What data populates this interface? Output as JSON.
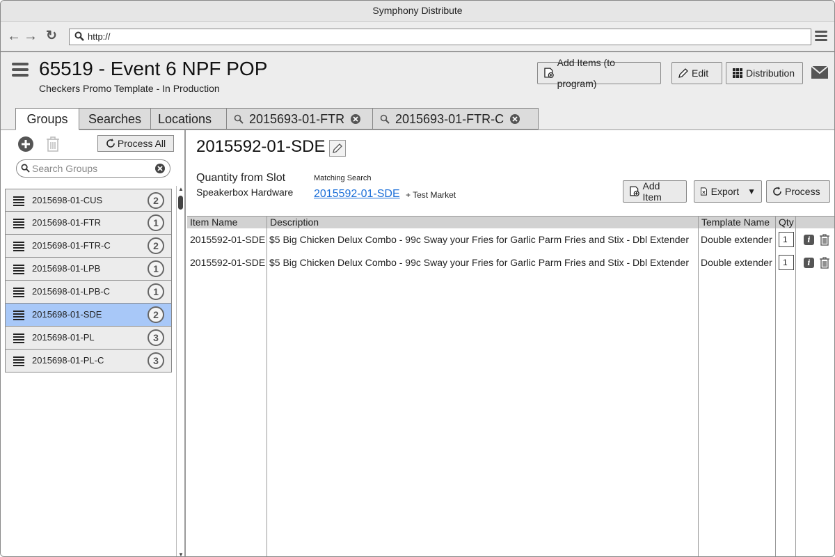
{
  "window": {
    "title": "Symphony Distribute"
  },
  "browser": {
    "url": "http://"
  },
  "header": {
    "title": "65519 - Event 6 NPF POP",
    "subtitle": "Checkers Promo Template - In Production",
    "buttons": {
      "add_items": "Add Items (to program)",
      "edit": "Edit",
      "distribution": "Distribution"
    }
  },
  "tabs": [
    {
      "label": "Groups",
      "active": true
    },
    {
      "label": "Searches"
    },
    {
      "label": "Locations"
    },
    {
      "label": "2015693-01-FTR",
      "closable": true
    },
    {
      "label": "2015693-01-FTR-C",
      "closable": true
    }
  ],
  "sidebar": {
    "process_all": "Process All",
    "search_placeholder": "Search Groups",
    "groups": [
      {
        "name": "2015698-01-CUS",
        "count": "2"
      },
      {
        "name": "2015698-01-FTR",
        "count": "1"
      },
      {
        "name": "2015698-01-FTR-C",
        "count": "2"
      },
      {
        "name": "2015698-01-LPB",
        "count": "1"
      },
      {
        "name": "2015698-01-LPB-C",
        "count": "1"
      },
      {
        "name": "2015698-01-SDE",
        "count": "2",
        "selected": true
      },
      {
        "name": "2015698-01-PL",
        "count": "3"
      },
      {
        "name": "2015698-01-PL-C",
        "count": "3"
      }
    ]
  },
  "detail": {
    "title": "2015592-01-SDE",
    "qty_label": "Quantity from Slot",
    "hardware": "Speakerbox Hardware",
    "matching_label": "Matching Search",
    "matching_link": "2015592-01-SDE",
    "test_market": "+ Test Market",
    "buttons": {
      "add_item": "Add Item",
      "export": "Export",
      "process": "Process"
    }
  },
  "table": {
    "headers": {
      "item": "Item Name",
      "desc": "Description",
      "template": "Template Name",
      "qty": "Qty"
    },
    "rows": [
      {
        "item": "2015592-01-SDE",
        "desc": "$5 Big Chicken Delux Combo - 99c Sway your Fries for Garlic Parm Fries and Stix - Dbl Extender",
        "template": "Double extender",
        "qty": "1"
      },
      {
        "item": "2015592-01-SDE",
        "desc": "$5 Big Chicken Delux Combo - 99c Sway your Fries for Garlic Parm Fries and Stix - Dbl Extender",
        "template": "Double extender",
        "qty": "1"
      }
    ]
  }
}
